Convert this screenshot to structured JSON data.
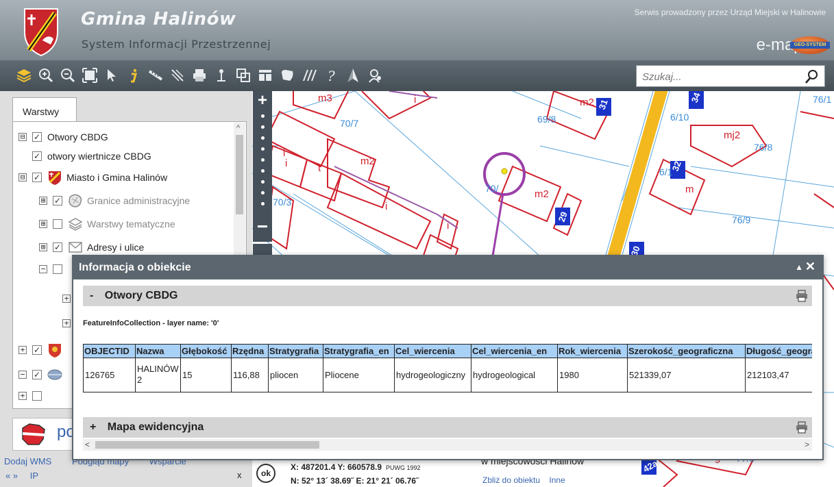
{
  "header": {
    "title": "Gmina Halinów",
    "subtitle": "System Informacji Przestrzennej",
    "service_note": "Serwis prowadzony przez Urząd Miejski w Halinowie",
    "emapa_logo": "e-mapa",
    "geosystem_logo": "GEO-SYSTEM"
  },
  "toolbar": {
    "tools": [
      "layers-icon",
      "zoom-in-icon",
      "zoom-out-icon",
      "zoom-extent-icon",
      "pointer-icon",
      "info-icon",
      "measure-distance-icon",
      "measure-area-icon",
      "print-icon",
      "marker-icon",
      "window-copy-icon",
      "legend-icon",
      "shape-icon",
      "hatch-icon",
      "help-icon",
      "north-arrow-icon",
      "user-location-icon"
    ],
    "search_placeholder": "Szukaj..."
  },
  "left_panel": {
    "tab_label": "Warstwy",
    "layers": [
      {
        "expander": "⊟",
        "checked": "✓",
        "label": "Otwory CBDG"
      },
      {
        "expander": "",
        "checked": "✓",
        "label": "otwory wiertnicze CBDG"
      },
      {
        "expander": "⊟",
        "checked": "✓",
        "label": "Miasto i Gmina Halinów"
      },
      {
        "expander": "⊞",
        "checked": "✓",
        "label": "Granice administracyjne"
      },
      {
        "expander": "⊞",
        "checked": "",
        "label": "Warstwy tematyczne"
      },
      {
        "expander": "⊞",
        "checked": "✓",
        "label": "Adresy i ulice"
      }
    ],
    "footer_links": [
      "Dodaj WMS",
      "Podgląd mapy",
      "Wsparcie"
    ],
    "footer_nav": "« »",
    "footer_ip": "IP",
    "footer_close": "x",
    "poland_logo_text": "po"
  },
  "map": {
    "zoom_in": "+",
    "zoom_out": "−",
    "labels": [
      "m3",
      "i",
      "m2",
      "31",
      "34",
      "76/1",
      "70/7",
      "69/8",
      "6/10",
      "mj2",
      "76/8",
      "i",
      "m2",
      "i",
      "t",
      "70/",
      "m2",
      "6/1",
      "32",
      "m",
      "70/3",
      "i",
      "i",
      "29",
      "76/9",
      "30",
      "9",
      "77/5",
      "42a"
    ],
    "coordinates": {
      "xy": "X: 487201.4   Y: 660578.9",
      "crs": "PUWG 1992",
      "ne": "N: 52° 13´ 38.69˝  E: 21° 21´ 06.76˝"
    },
    "ok_button": "ok",
    "place_text": "w miejscowości Halinów",
    "place_links": [
      "Zbliż do obiektu",
      "Inne"
    ]
  },
  "popup": {
    "title": "Informacja o obiekcie",
    "minimize": "▲",
    "close": "✕",
    "sections": [
      {
        "toggle": "-",
        "title": "Otwory CBDG"
      },
      {
        "toggle": "+",
        "title": "Mapa ewidencyjna"
      }
    ],
    "feature_caption": "FeatureInfoCollection - layer name: '0'",
    "table": {
      "columns": [
        "OBJECTID",
        "Nazwa",
        "Głębokość",
        "Rzędna",
        "Stratygrafia",
        "Stratygrafia_en",
        "Cel_wiercenia",
        "Cel_wiercenia_en",
        "Rok_wiercenia",
        "Szerokość_geograficzna",
        "Długość_geograficzna"
      ],
      "rows": [
        [
          "126765",
          "HALINÓW 2",
          "15",
          "116,88",
          "pliocen",
          "Pliocene",
          "hydrogeologiczny",
          "hydrogeological",
          "1980",
          "521339,07",
          "212103,47"
        ]
      ]
    },
    "hscroll_left": "<",
    "hscroll_right": ">"
  }
}
